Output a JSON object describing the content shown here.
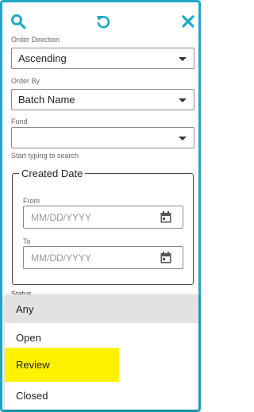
{
  "toolbar": {
    "search_icon": "search-icon",
    "reset_icon": "reset-icon",
    "close_icon": "close-icon",
    "accent_color": "#1fa8c6"
  },
  "order_direction": {
    "label": "Order Direction",
    "value": "Ascending"
  },
  "order_by": {
    "label": "Order By",
    "value": "Batch Name"
  },
  "fund": {
    "label": "Fund",
    "value": "",
    "hint": "Start typing to search"
  },
  "created_date": {
    "legend": "Created Date",
    "from": {
      "label": "From",
      "placeholder": "MM/DD/YYYY"
    },
    "to": {
      "label": "To",
      "placeholder": "MM/DD/YYYY"
    }
  },
  "status": {
    "label": "Status",
    "options": [
      "Any",
      "Open",
      "Review",
      "Closed"
    ],
    "hovered": "Any",
    "highlighted": "Review",
    "highlight_color": "#fff200"
  }
}
